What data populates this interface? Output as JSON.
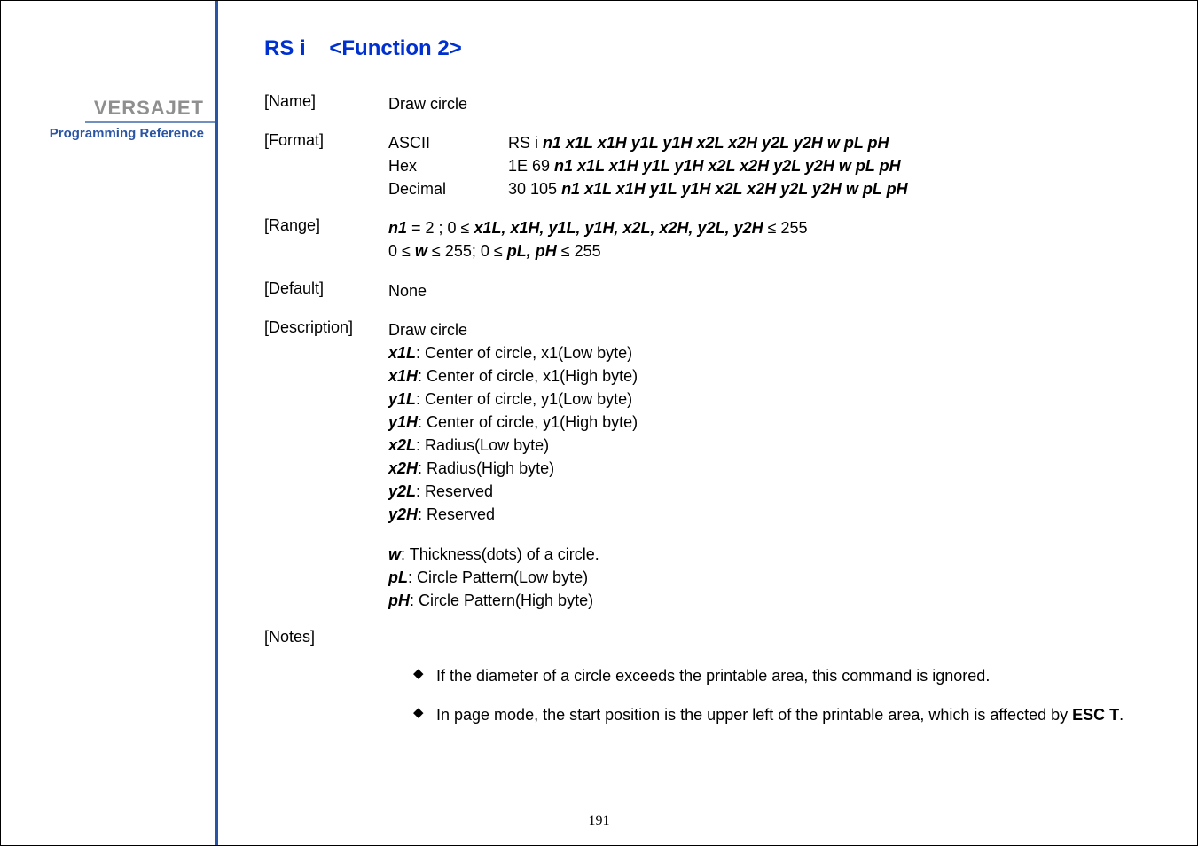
{
  "sidebar": {
    "brand": "VERSAJET",
    "subtitle": "Programming Reference"
  },
  "title_cmd": "RS i",
  "title_func": "<Function 2>",
  "name": {
    "label": "[Name]",
    "value": "Draw circle"
  },
  "format": {
    "label": "[Format]",
    "ascii_lbl": "ASCII",
    "ascii_pre": "RS i   ",
    "ascii_params": "n1 x1L x1H y1L y1H x2L x2H y2L y2H w pL pH",
    "hex_lbl": "Hex",
    "hex_pre": "1E 69 ",
    "hex_params": "n1 x1L x1H y1L y1H x2L x2H y2L y2H w pL pH",
    "dec_lbl": "Decimal",
    "dec_pre": "30 105 ",
    "dec_params": "n1 x1L x1H y1L y1H x2L x2H y2L y2H w pL pH"
  },
  "range": {
    "label": "[Range]",
    "l1_a": "n1",
    "l1_b": " = 2 ; 0 ≤ ",
    "l1_c": "x1L, x1H, y1L, y1H, x2L, x2H, y2L, y2H",
    "l1_d": " ≤ 255",
    "l2_a": " 0 ≤ ",
    "l2_b": "w",
    "l2_c": " ≤ 255; 0 ≤ ",
    "l2_d": "pL, pH",
    "l2_e": " ≤ 255"
  },
  "default": {
    "label": "[Default]",
    "value": "None"
  },
  "description": {
    "label": "[Description]",
    "head": "Draw circle",
    "items": {
      "x1L_k": "x1L",
      "x1L_v": ": Center of circle, x1(Low byte)",
      "x1H_k": "x1H",
      "x1H_v": ": Center of circle, x1(High byte)",
      "y1L_k": "y1L",
      "y1L_v": ": Center of circle, y1(Low byte)",
      "y1H_k": "y1H",
      "y1H_v": ": Center of circle, y1(High byte)",
      "x2L_k": "x2L",
      "x2L_v": ": Radius(Low byte)",
      "x2H_k": "x2H",
      "x2H_v": ": Radius(High byte)",
      "y2L_k": "y2L",
      "y2L_v": ": Reserved",
      "y2H_k": "y2H",
      "y2H_v": ": Reserved",
      "w_k": "w",
      "w_v": ": Thickness(dots) of a circle.",
      "pL_k": "pL",
      "pL_v": ": Circle Pattern(Low byte)",
      "pH_k": "pH",
      "pH_v": ": Circle Pattern(High byte)"
    }
  },
  "notes": {
    "label": "[Notes]",
    "n1": "If the diameter of a circle exceeds the printable area, this command is ignored.",
    "n2a": "In page mode, the start position is the upper left of the printable area, which is affected by ",
    "n2b": "ESC T",
    "n2c": "."
  },
  "pagenum": "191"
}
